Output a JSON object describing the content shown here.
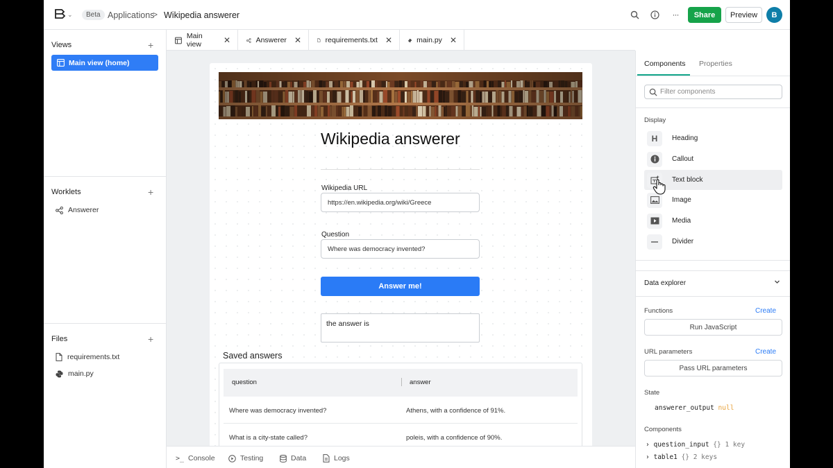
{
  "topbar": {
    "beta": "Beta",
    "breadcrumb_app": "Applications",
    "breadcrumb_sep": ">",
    "breadcrumb_current": "Wikipedia answerer",
    "share_label": "Share",
    "preview_label": "Preview",
    "avatar_initial": "B",
    "more_glyph": "···"
  },
  "sidebar": {
    "views_heading": "Views",
    "views": [
      {
        "label": "Main view (home)"
      }
    ],
    "worklets_heading": "Worklets",
    "worklets": [
      {
        "label": "Answerer"
      }
    ],
    "files_heading": "Files",
    "files": [
      {
        "label": "requirements.txt"
      },
      {
        "label": "main.py"
      }
    ],
    "add_glyph": "+"
  },
  "tabs": [
    {
      "label": "Main view",
      "icon": "layout-icon"
    },
    {
      "label": "Answerer",
      "icon": "share-nodes-icon"
    },
    {
      "label": "requirements.txt",
      "icon": "file-icon"
    },
    {
      "label": "main.py",
      "icon": "python-icon"
    }
  ],
  "app": {
    "title": "Wikipedia answerer",
    "url_label": "Wikipedia URL",
    "url_value": "https://en.wikipedia.org/wiki/Greece",
    "question_label": "Question",
    "question_value": "Where was democracy invented?",
    "button_label": "Answer me!",
    "answer_text": "the answer is",
    "saved_title": "Saved answers",
    "table": {
      "columns": [
        "question",
        "answer"
      ],
      "rows": [
        [
          "Where was democracy invented?",
          "Athens, with a confidence of 91%."
        ],
        [
          "What is a city-state called?",
          "poleis, with a confidence of 90%."
        ]
      ]
    }
  },
  "bottombar": [
    {
      "label": "Console",
      "icon": "terminal-icon"
    },
    {
      "label": "Testing",
      "icon": "play-circle-icon"
    },
    {
      "label": "Data",
      "icon": "database-icon"
    },
    {
      "label": "Logs",
      "icon": "file-text-icon"
    }
  ],
  "right_panel": {
    "tab_components": "Components",
    "tab_properties": "Properties",
    "filter_placeholder": "Filter components",
    "display_label": "Display",
    "components": [
      {
        "label": "Heading",
        "icon": "heading-icon"
      },
      {
        "label": "Callout",
        "icon": "info-icon"
      },
      {
        "label": "Text block",
        "icon": "text-block-icon"
      },
      {
        "label": "Image",
        "icon": "image-icon"
      },
      {
        "label": "Media",
        "icon": "play-icon"
      },
      {
        "label": "Divider",
        "icon": "divider-icon"
      }
    ],
    "data_explorer": "Data explorer",
    "functions_label": "Functions",
    "create_label": "Create",
    "run_js_label": "Run JavaScript",
    "url_params_label": "URL parameters",
    "pass_url_label": "Pass URL parameters",
    "state_label": "State",
    "state_var": "answerer_output",
    "state_value": "null",
    "components_label": "Components",
    "tree": [
      {
        "name": "question_input",
        "type": "{}",
        "detail": "1 key"
      },
      {
        "name": "table1",
        "type": "{}",
        "detail": "2 keys"
      }
    ]
  },
  "colors": {
    "accent_blue": "#2a7bf6",
    "share_green": "#16a34a",
    "tab_underline": "#12a58a",
    "null_orange": "#e8a33d"
  }
}
